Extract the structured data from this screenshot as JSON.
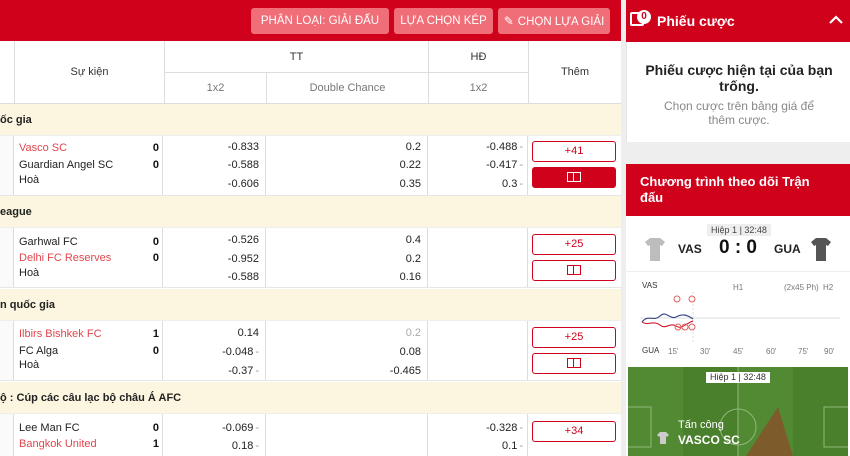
{
  "toolbar": {
    "filter_label": "PHÂN LOẠI: GIẢI ĐẤU",
    "multi_label": "LỰA CHỌN KÉP",
    "choose_label": "CHỌN LỰA GIẢI"
  },
  "table_header": {
    "event": "Sự kiện",
    "tt": "TT",
    "hd": "HĐ",
    "more": "Thêm",
    "tt_1x2": "1x2",
    "tt_dc": "Double Chance",
    "hd_1x2": "1x2"
  },
  "leagues": [
    {
      "name": "ốc gia"
    },
    {
      "name": "eague"
    },
    {
      "name": "n quốc gia"
    },
    {
      "name": "ộ : Cúp các câu lạc bộ châu Á AFC"
    }
  ],
  "matches": [
    {
      "home": "Vasco SC",
      "home_score": "0",
      "away": "Guardian Angel SC",
      "away_score": "0",
      "draw": "Hoà",
      "tt1": [
        "-0.833",
        "-0.588",
        "-0.606"
      ],
      "dc": [
        "0.2",
        "0.22",
        "0.35"
      ],
      "hd": [
        "-0.488",
        "-0.417",
        "0.3"
      ],
      "more": "+41"
    },
    {
      "home": "Garhwal FC",
      "home_score": "0",
      "away": "Delhi FC Reserves",
      "away_score": "0",
      "draw": "Hoà",
      "tt1": [
        "-0.526",
        "-0.952",
        "-0.588"
      ],
      "dc": [
        "0.4",
        "0.2",
        "0.16"
      ],
      "more": "+25"
    },
    {
      "home": "Ilbirs Bishkek FC",
      "home_score": "1",
      "away": "FC Alga",
      "away_score": "0",
      "draw": "Hoà",
      "tt1": [
        "0.14",
        "-0.048",
        "-0.37"
      ],
      "dc": [
        "0.2",
        "0.08",
        "-0.465"
      ],
      "more": "+25"
    },
    {
      "home": "Lee Man FC",
      "home_score": "0",
      "away": "Bangkok United",
      "away_score": "1",
      "tt1": [
        "-0.069",
        "0.18"
      ],
      "hd": [
        "-0.328",
        "0.1"
      ],
      "more": "+34"
    }
  ],
  "betslip": {
    "badge": "0",
    "title": "Phiếu cược",
    "empty_title": "Phiếu cược hiện tại của bạn trống.",
    "empty_hint": "Chọn cược trên bảng giá để thêm cược."
  },
  "tracker": {
    "title": "Chương trình theo dõi Trận đấu",
    "period": "Hiệp 1 | 32:48",
    "home": "VAS",
    "away": "GUA",
    "score": "0 : 0",
    "mom_home": "VAS",
    "mom_away": "GUA",
    "h1": "H1",
    "extra": "(2x45 Ph)",
    "h2": "H2",
    "ticks": [
      "15'",
      "30'",
      "45'",
      "60'",
      "75'",
      "90'"
    ],
    "field_period": "Hiệp 1 | 32:48",
    "attack_label": "Tấn công",
    "attack_team": "VASCO SC"
  },
  "colors": {
    "brand": "#d0021b",
    "button": "#f06e78",
    "league_bg": "#fcf6e0",
    "pitch": "#4a7f2c"
  }
}
